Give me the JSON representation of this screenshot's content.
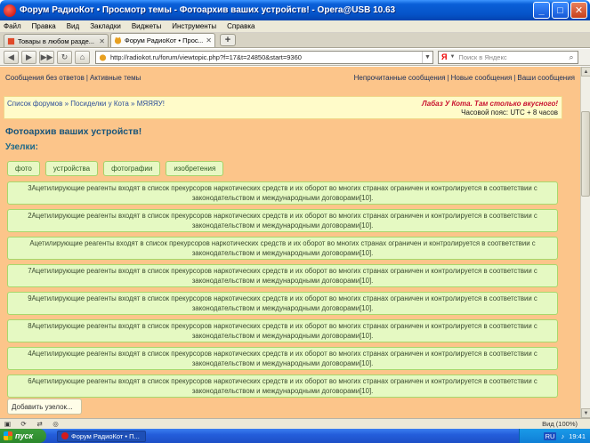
{
  "window": {
    "title": "Форум РадиоКот • Просмотр темы - Фотоархив ваших устройств! - Opera@USB 10.63"
  },
  "menu": [
    "Файл",
    "Правка",
    "Вид",
    "Закладки",
    "Виджеты",
    "Инструменты",
    "Справка"
  ],
  "tabs": [
    {
      "label": "Товары в любом разде..."
    },
    {
      "label": "Форум РадиоКот • Прос..."
    }
  ],
  "address": {
    "url": "http://radiokot.ru/forum/viewtopic.php?f=17&t=24850&start=9360",
    "search_placeholder": "Поиск в Яндекс",
    "search_engine": "Я"
  },
  "page": {
    "top_links_left": [
      "Сообщения без ответов",
      "Активные темы"
    ],
    "top_links_right": [
      "Непрочитанные сообщения",
      "Новые сообщения",
      "Ваши сообщения"
    ],
    "breadcrumb": "Список форумов » Посиделки у Кота » МЯЯЯУ!",
    "promo": "Лабаз У Кота. Там столько вкусного!",
    "timezone": "Часовой пояс: UTC + 8 часов",
    "title": "Фотоархив ваших устройств!",
    "nodes_label": "Узелки:",
    "tags": [
      "фото",
      "устройства",
      "фотографии",
      "изобретения"
    ],
    "posts": [
      "3Ацетилирующие реагенты входят в список прекурсоров наркотических средств и их оборот во многих странах ограничен и контролируется в соответствии с законодательством и международными договорами[10].",
      "2Ацетилирующие реагенты входят в список прекурсоров наркотических средств и их оборот во многих странах ограничен и контролируется в соответствии с законодательством и международными договорами[10].",
      "Ацетилирующие реагенты входят в список прекурсоров наркотических средств и их оборот во многих странах ограничен и контролируется в соответствии с законодательством и международными договорами[10].",
      "7Ацетилирующие реагенты входят в список прекурсоров наркотических средств и их оборот во многих странах ограничен и контролируется в соответствии с законодательством и международными договорами[10].",
      "9Ацетилирующие реагенты входят в список прекурсоров наркотических средств и их оборот во многих странах ограничен и контролируется в соответствии с законодательством и международными договорами[10].",
      "8Ацетилирующие реагенты входят в список прекурсоров наркотических средств и их оборот во многих странах ограничен и контролируется в соответствии с законодательством и международными договорами[10].",
      "4Ацетилирующие реагенты входят в список прекурсоров наркотических средств и их оборот во многих странах ограничен и контролируется в соответствии с законодательством и международными договорами[10].",
      "6Ацетилирующие реагенты входят в список прекурсоров наркотических средств и их оборот во многих странах ограничен и контролируется в соответствии с законодательством и международными договорами[10]."
    ],
    "add_node": "Добавить узелок..."
  },
  "statusbar": {
    "zoom": "Вид (100%)"
  },
  "taskbar": {
    "start": "пуск",
    "item": "Форум РадиоКот • П...",
    "lang": "RU",
    "time": "19:41"
  },
  "colors": {
    "page_bg": "#fcc58a",
    "post_bg": "#e5f9c2",
    "title_color": "#19557a",
    "promo_color": "#c8102e"
  }
}
